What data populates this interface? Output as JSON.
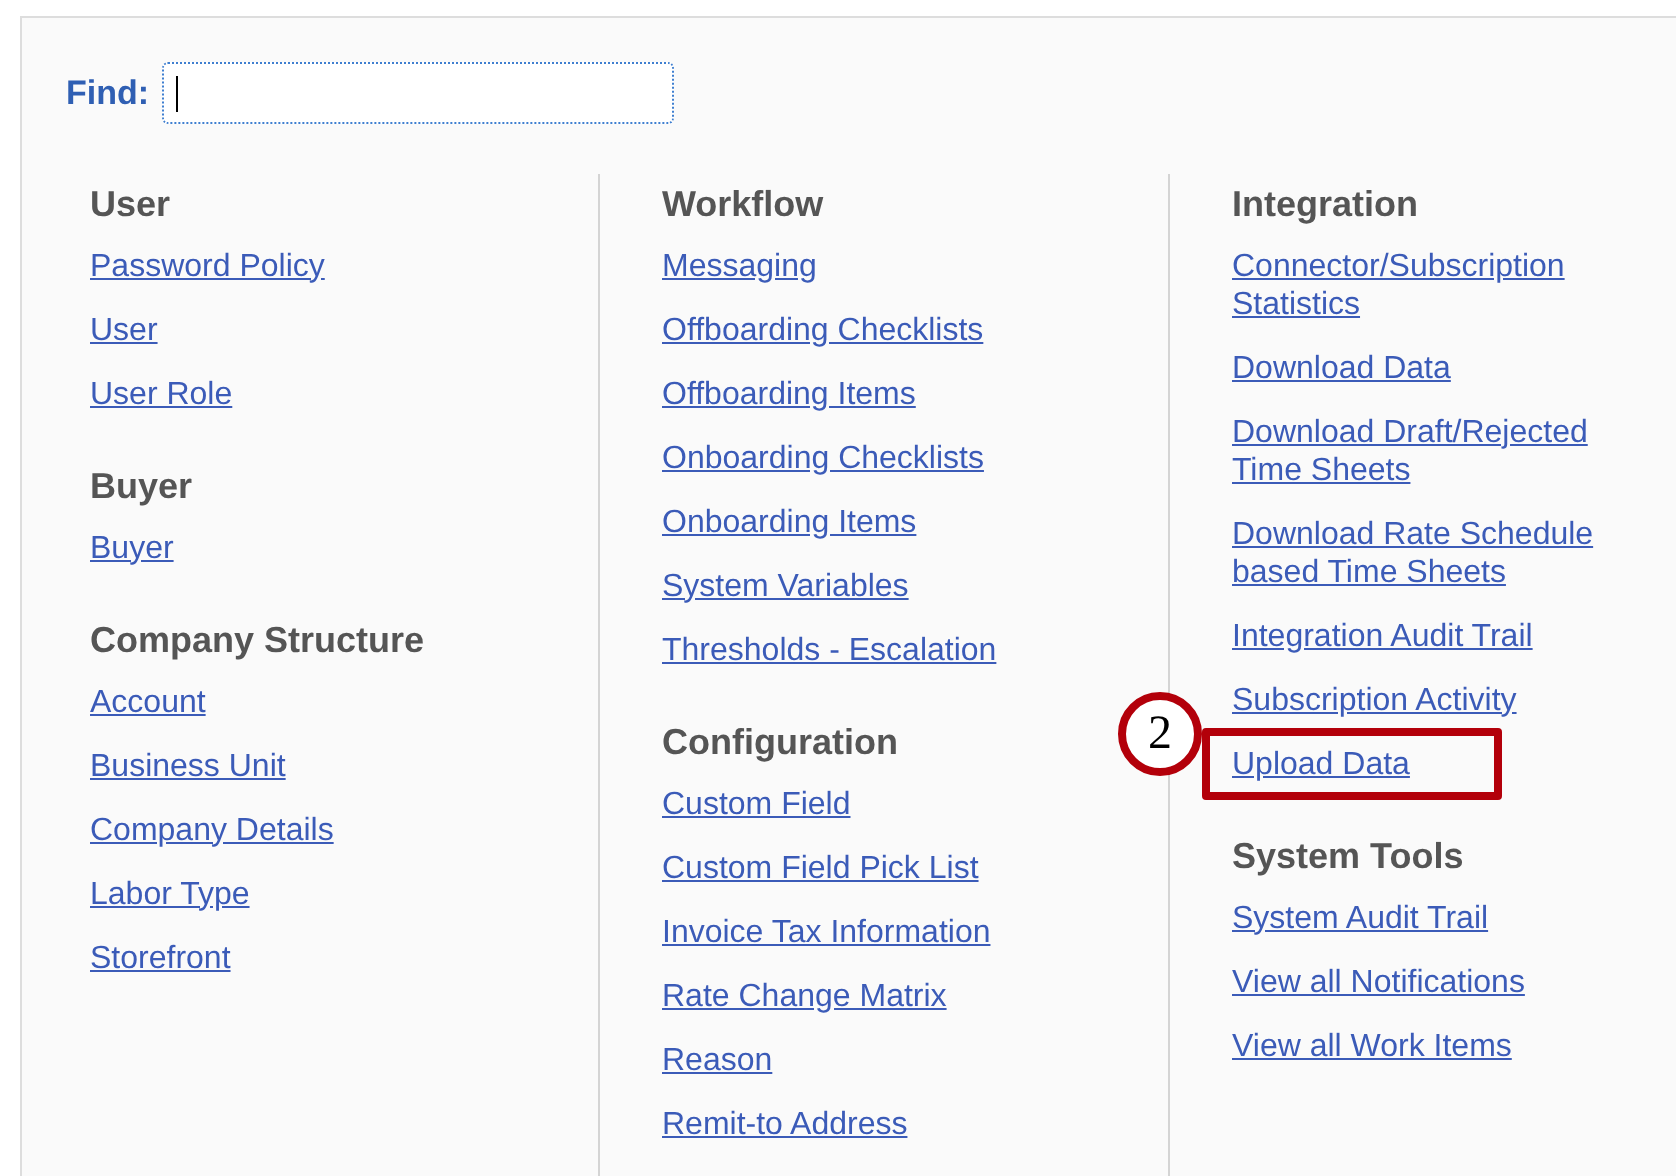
{
  "find": {
    "label": "Find:"
  },
  "columns": [
    {
      "sections": [
        {
          "title": "User",
          "links": [
            {
              "text": "Password Policy",
              "highlighted": false
            },
            {
              "text": "User",
              "highlighted": false
            },
            {
              "text": "User Role",
              "highlighted": false
            }
          ]
        },
        {
          "title": "Buyer",
          "links": [
            {
              "text": "Buyer",
              "highlighted": false
            }
          ]
        },
        {
          "title": "Company Structure",
          "links": [
            {
              "text": "Account",
              "highlighted": false
            },
            {
              "text": "Business Unit",
              "highlighted": false
            },
            {
              "text": "Company Details",
              "highlighted": false
            },
            {
              "text": "Labor Type",
              "highlighted": false
            },
            {
              "text": "Storefront",
              "highlighted": false
            }
          ]
        }
      ]
    },
    {
      "sections": [
        {
          "title": "Workflow",
          "links": [
            {
              "text": "Messaging",
              "highlighted": false
            },
            {
              "text": "Offboarding Checklists",
              "highlighted": false
            },
            {
              "text": "Offboarding Items",
              "highlighted": false
            },
            {
              "text": "Onboarding Checklists",
              "highlighted": false
            },
            {
              "text": "Onboarding Items",
              "highlighted": false
            },
            {
              "text": "System Variables",
              "highlighted": false
            },
            {
              "text": "Thresholds - Escalation",
              "highlighted": false
            }
          ]
        },
        {
          "title": "Configuration",
          "links": [
            {
              "text": "Custom Field",
              "highlighted": false
            },
            {
              "text": "Custom Field Pick List",
              "highlighted": false
            },
            {
              "text": "Invoice Tax Information",
              "highlighted": false
            },
            {
              "text": "Rate Change Matrix",
              "highlighted": false
            },
            {
              "text": "Reason",
              "highlighted": false
            },
            {
              "text": "Remit-to Address",
              "highlighted": false
            }
          ]
        }
      ]
    },
    {
      "sections": [
        {
          "title": "Integration",
          "links": [
            {
              "text": "Connector/Subscription Statistics",
              "highlighted": false
            },
            {
              "text": "Download Data",
              "highlighted": false
            },
            {
              "text": "Download Draft/Rejected Time Sheets",
              "highlighted": false
            },
            {
              "text": "Download Rate Schedule based Time Sheets",
              "highlighted": false
            },
            {
              "text": "Integration Audit Trail",
              "highlighted": false
            },
            {
              "text": "Subscription Activity",
              "highlighted": false
            },
            {
              "text": "Upload Data",
              "highlighted": true,
              "callout": "2"
            }
          ]
        },
        {
          "title": "System Tools",
          "links": [
            {
              "text": "System Audit Trail",
              "highlighted": false
            },
            {
              "text": "View all Notifications",
              "highlighted": false
            },
            {
              "text": "View all Work Items",
              "highlighted": false
            }
          ]
        }
      ]
    }
  ]
}
